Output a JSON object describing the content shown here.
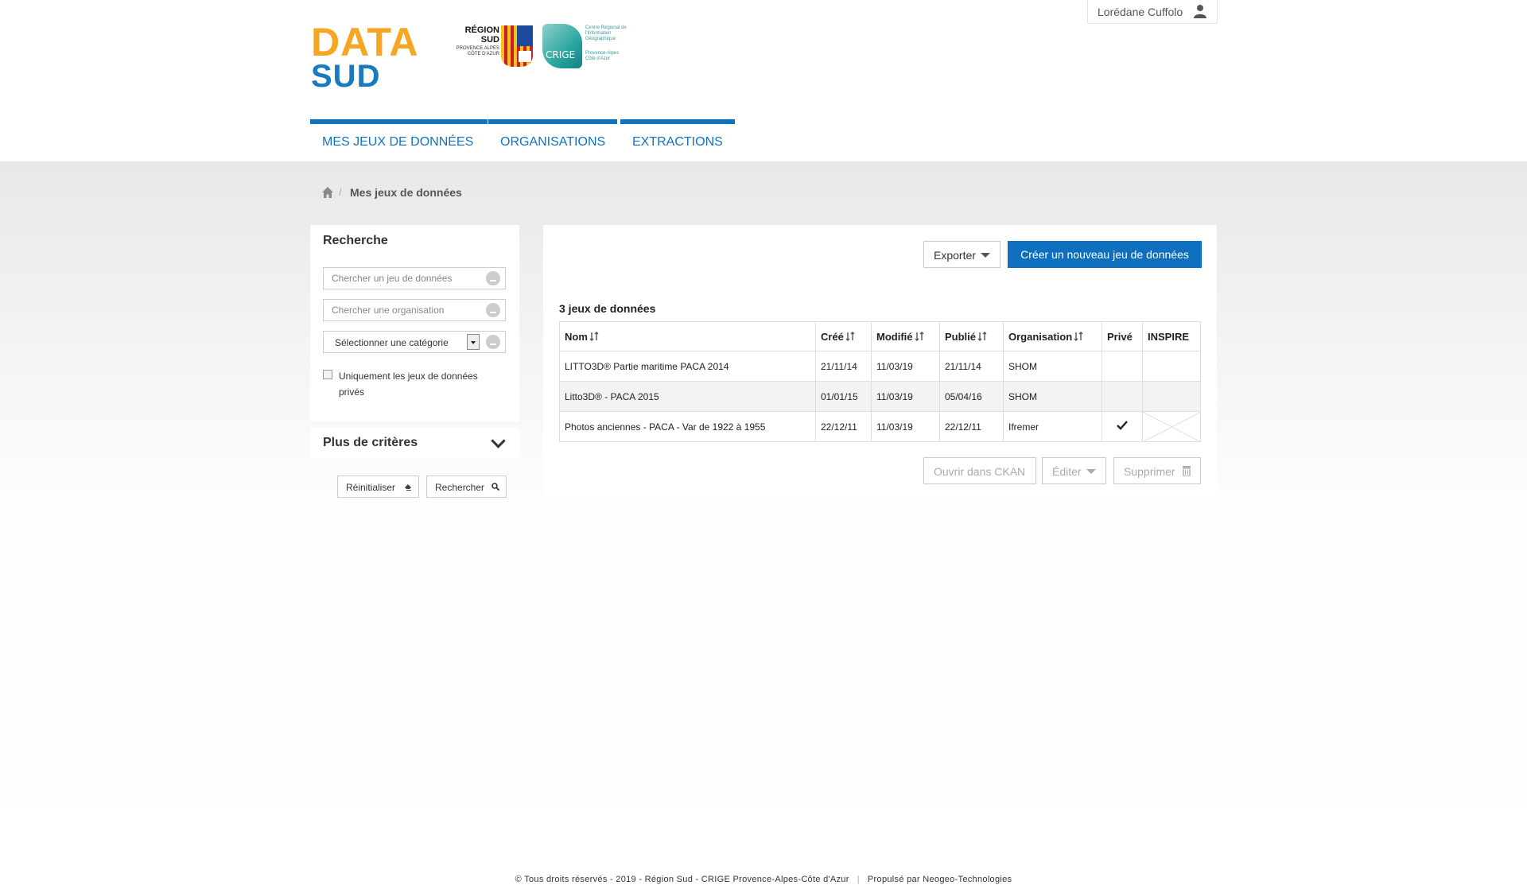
{
  "header": {
    "logo_line1": "DATA",
    "logo_line2": "SUD",
    "partner1_title": "RÉGION SUD",
    "partner1_sub": "PROVENCE ALPES CÔTE D'AZUR",
    "partner2_word": "CRIGE",
    "partner2_text": "Centre Régional de l'Information Géographique",
    "partner2_text2": "Provence-Alpes Côte d'Azur",
    "user_name": "Lorédane Cuffolo"
  },
  "colors": {
    "brand_orange": "#f5a623",
    "brand_blue": "#1173bd",
    "primary_button": "#0d6fbd"
  },
  "nav": {
    "items": [
      {
        "label": "MES JEUX DE DONNÉES"
      },
      {
        "label": "ORGANISATIONS"
      },
      {
        "label": "EXTRACTIONS"
      }
    ]
  },
  "breadcrumb": {
    "separator": "/",
    "current": "Mes jeux de données"
  },
  "search": {
    "title": "Recherche",
    "dataset_placeholder": "Chercher un jeu de données",
    "org_placeholder": "Chercher une organisation",
    "category_value": "Sélectionner une catégorie",
    "private_only_label": "Uniquement les jeux de données privés",
    "more_criteria": "Plus de critères",
    "reset_label": "Réinitialiser",
    "search_label": "Rechercher"
  },
  "main": {
    "export_label": "Exporter",
    "create_label": "Créer un nouveau jeu de données",
    "count_label": "3 jeux de données",
    "columns": [
      "Nom",
      "Créé",
      "Modifié",
      "Publié",
      "Organisation",
      "Privé",
      "INSPIRE"
    ],
    "rows": [
      {
        "name": "LITTO3D® Partie maritime PACA 2014",
        "created": "21/11/14",
        "modified": "11/03/19",
        "published": "21/11/14",
        "org": "SHOM",
        "private": false
      },
      {
        "name": "Litto3D® - PACA 2015",
        "created": "01/01/15",
        "modified": "11/03/19",
        "published": "05/04/16",
        "org": "SHOM",
        "private": false
      },
      {
        "name": "Photos anciennes - PACA - Var de 1922 à 1955",
        "created": "22/12/11",
        "modified": "11/03/19",
        "published": "22/12/11",
        "org": "Ifremer",
        "private": true
      }
    ],
    "open_ckan_label": "Ouvrir dans CKAN",
    "edit_label": "Éditer",
    "delete_label": "Supprimer"
  },
  "footer": {
    "copyright": "© Tous droits réservés - 2019 - Région Sud - CRIGE Provence-Alpes-Côte d'Azur",
    "separator": "|",
    "powered": "Propulsé par Neogeo-Technologies"
  }
}
